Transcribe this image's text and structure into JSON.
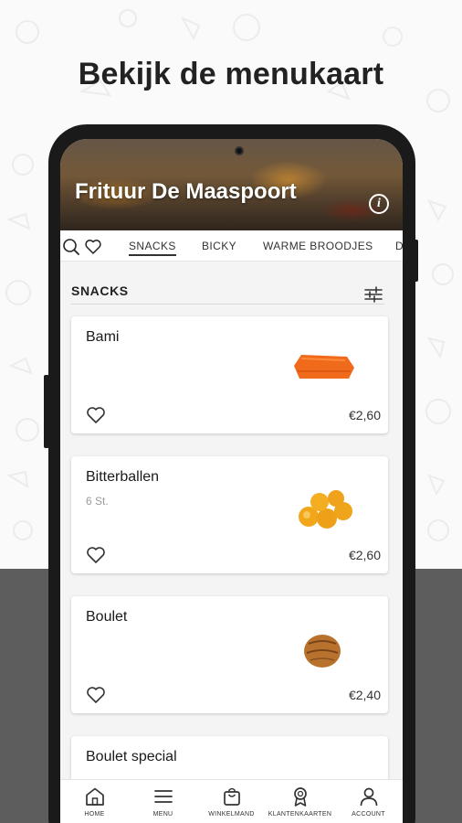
{
  "headline": "Bekijk de menukaart",
  "restaurant": {
    "name": "Frituur De Maaspoort",
    "info_icon": "info-icon"
  },
  "tabs": [
    {
      "label": "SNACKS",
      "active": true
    },
    {
      "label": "BICKY",
      "active": false
    },
    {
      "label": "WARME BROODJES",
      "active": false
    },
    {
      "label": "D",
      "active": false
    }
  ],
  "section": {
    "title": "SNACKS",
    "filter_icon": "sliders-icon"
  },
  "products": [
    {
      "name": "Bami",
      "description": "",
      "price": "€2,60",
      "image_icon": "bami-snack-image"
    },
    {
      "name": "Bitterballen",
      "description": "6 St.",
      "price": "€2,60",
      "image_icon": "bitterballen-image"
    },
    {
      "name": "Boulet",
      "description": "",
      "price": "€2,40",
      "image_icon": "boulet-image"
    },
    {
      "name": "Boulet special",
      "description": "",
      "price": "",
      "image_icon": "boulet-special-image"
    }
  ],
  "bottom_nav": [
    {
      "label": "HOME",
      "icon": "home-icon"
    },
    {
      "label": "MENU",
      "icon": "menu-icon"
    },
    {
      "label": "WINKELMAND",
      "icon": "shopping-bag-icon"
    },
    {
      "label": "KLANTENKAARTEN",
      "icon": "award-icon"
    },
    {
      "label": "ACCOUNT",
      "icon": "person-icon"
    }
  ],
  "colors": {
    "background_bottom": "#5e5d5e",
    "phone_frame": "#1a1a1a",
    "accent_text": "#222222"
  }
}
